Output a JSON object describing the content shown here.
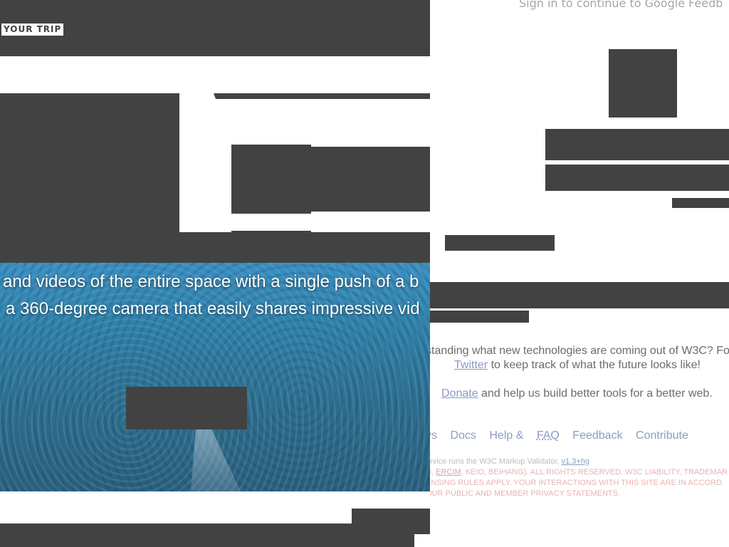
{
  "left": {
    "trip_label": "YOUR TRIP",
    "hero": {
      "line1": "and videos of the entire space with a single push of a b",
      "line2": "a 360-degree camera that easily shares impressive vid"
    }
  },
  "right": {
    "signin_text": "Sign in to continue to Google Feedb",
    "w3c": {
      "line1": "standing what new technologies are coming out of W3C? Fo",
      "twitter_link": "Twitter",
      "line2_rest": " to keep track of what the future looks like!",
      "donate_link": "Donate",
      "line3_rest": " and help us build better tools for a better web."
    },
    "footer_nav": {
      "news_partial": "vs",
      "docs": "Docs",
      "help_prefix": "Help & ",
      "faq": "FAQ",
      "feedback": "Feedback",
      "contribute": "Contribute"
    },
    "fine_print": {
      "line1_prefix": "ervice runs the W3C Markup Validator, ",
      "version": "v1.3+hg",
      "line2_prefix": "©, ",
      "ercim": "ERCIM",
      "line2_rest": ", KEIO, BEIHANG). ALL RIGHTS RESERVED. W3C LIABILITY, TRADEMAR",
      "line3": "ENSING RULES APPLY. YOUR INTERACTIONS WITH THIS SITE ARE IN ACCORD",
      "line4": "OUR PUBLIC AND MEMBER PRIVACY STATEMENTS."
    }
  },
  "colors": {
    "redaction": "#424242",
    "link": "#8a9cc4",
    "body_text": "#6b6b6b",
    "signin_text": "#a6a6a6"
  }
}
